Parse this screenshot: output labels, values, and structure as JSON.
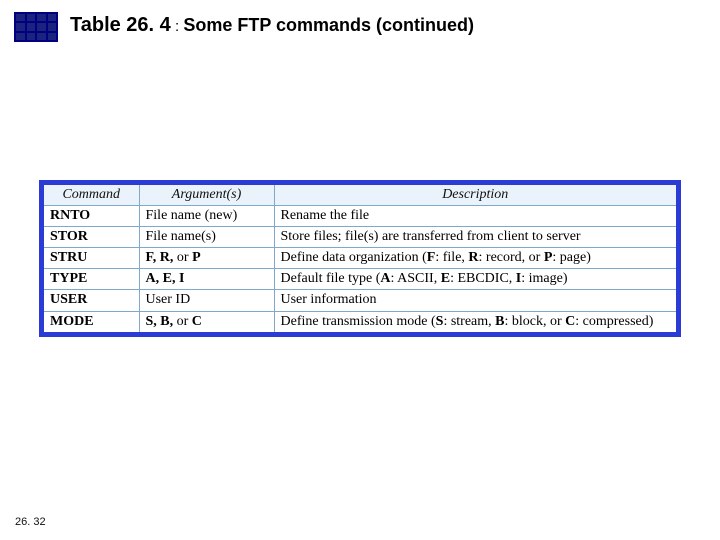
{
  "title": {
    "table_no": "Table 26. 4",
    "colon": " : ",
    "name": "Some FTP commands (continued)"
  },
  "columns": {
    "c1": "Command",
    "c2": "Argument(s)",
    "c3": "Description"
  },
  "rows": [
    {
      "cmd": "RNTO",
      "arg_plain": "File name (new)",
      "desc_plain": "Rename the file"
    },
    {
      "cmd": "STOR",
      "arg_plain": "File name(s)",
      "desc_plain": "Store files; file(s) are transferred from client to server"
    },
    {
      "cmd": "STRU",
      "arg_bold": "F, R, ",
      "arg_mid": "or ",
      "arg_bold2": "P",
      "d_a": "Define data organization (",
      "d_k1": "F",
      "d_b": ": file, ",
      "d_k2": "R",
      "d_c": ": record, or ",
      "d_k3": "P",
      "d_d": ": page)"
    },
    {
      "cmd": "TYPE",
      "arg_bold": "A, E, I",
      "d_a": "Default file type (",
      "d_k1": "A",
      "d_b": ": ASCII, ",
      "d_k2": "E",
      "d_c": ": EBCDIC, ",
      "d_k3": "I",
      "d_d": ": image)"
    },
    {
      "cmd": "USER",
      "arg_plain": "User ID",
      "desc_plain": "User information"
    },
    {
      "cmd": "MODE",
      "arg_bold": "S, B, ",
      "arg_mid": "or ",
      "arg_bold2": "C",
      "d_a": "Define transmission mode (",
      "d_k1": "S",
      "d_b": ": stream, ",
      "d_k2": "B",
      "d_c": ": block, or ",
      "d_k3": "C",
      "d_d": ": compressed)"
    }
  ],
  "footer": "26. 32",
  "chart_data": {
    "type": "table",
    "title": "Table 26.4 : Some FTP commands (continued)",
    "columns": [
      "Command",
      "Argument(s)",
      "Description"
    ],
    "rows": [
      [
        "RNTO",
        "File name (new)",
        "Rename the file"
      ],
      [
        "STOR",
        "File name(s)",
        "Store files; file(s) are transferred from client to server"
      ],
      [
        "STRU",
        "F, R, or P",
        "Define data organization (F: file, R: record, or P: page)"
      ],
      [
        "TYPE",
        "A, E, I",
        "Default file type (A: ASCII, E: EBCDIC, I: image)"
      ],
      [
        "USER",
        "User ID",
        "User information"
      ],
      [
        "MODE",
        "S, B, or C",
        "Define transmission mode (S: stream, B: block, or C: compressed)"
      ]
    ]
  }
}
